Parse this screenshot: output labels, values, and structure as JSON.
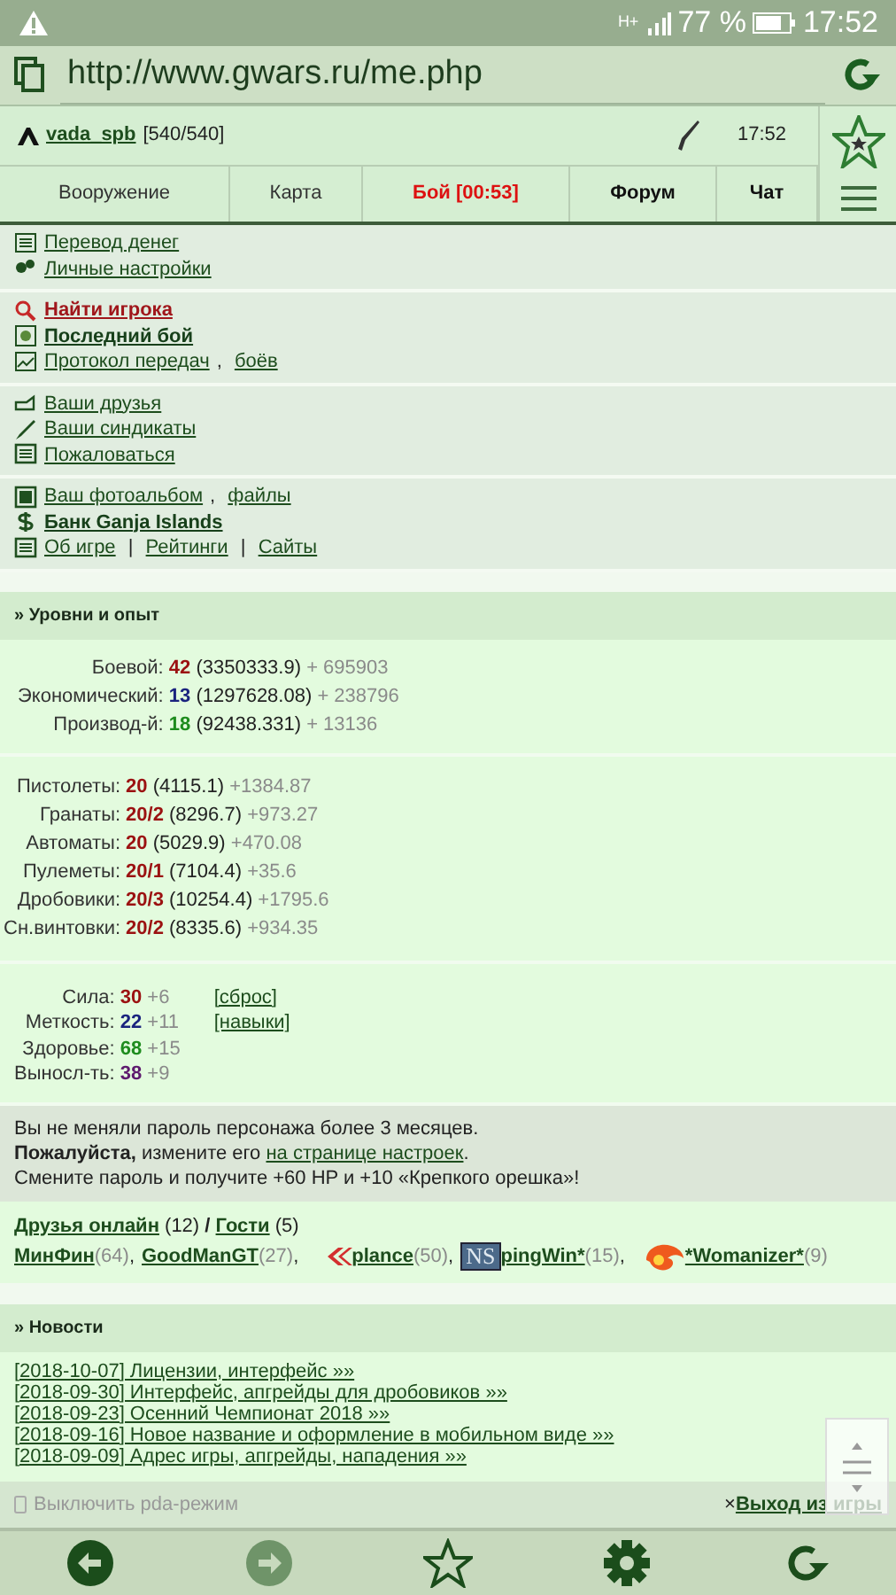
{
  "status_bar": {
    "network": "H+",
    "battery": "77 %",
    "time": "17:52"
  },
  "address_bar": {
    "url": "http://www.gwars.ru/me.php"
  },
  "header": {
    "user": "vada_spb",
    "hp": "[540/540]",
    "time": "17:52"
  },
  "nav_tabs": [
    {
      "label": "Вооружение",
      "kind": "plain"
    },
    {
      "label": "Карта",
      "kind": "plain"
    },
    {
      "label": "Бой [00:53]",
      "kind": "alert"
    },
    {
      "label": "Форум",
      "kind": "bold"
    },
    {
      "label": "Чат",
      "kind": "bold"
    }
  ],
  "menu_groups": [
    [
      {
        "kind": "plain",
        "links": [
          "Перевод денег"
        ]
      },
      {
        "kind": "plain",
        "links": [
          "Личные настройки"
        ]
      }
    ],
    [
      {
        "kind": "alert",
        "links": [
          "Найти игрока"
        ]
      },
      {
        "kind": "bold",
        "links": [
          "Последний бой"
        ]
      },
      {
        "kind": "plain",
        "links": [
          "Протокол передач",
          "боёв"
        ],
        "separator": ", "
      }
    ],
    [
      {
        "kind": "plain",
        "links": [
          "Ваши друзья"
        ]
      },
      {
        "kind": "plain",
        "links": [
          "Ваши синдикаты"
        ]
      },
      {
        "kind": "plain",
        "links": [
          "Пожаловаться"
        ]
      }
    ],
    [
      {
        "kind": "plain",
        "links": [
          "Ваш фотоальбом",
          "файлы"
        ],
        "separator": ", "
      },
      {
        "kind": "bold",
        "links": [
          "Банк Ganja Islands"
        ]
      },
      {
        "kind": "plain",
        "links": [
          "Об игре",
          "Рейтинги",
          "Сайты"
        ],
        "separator": " | "
      }
    ]
  ],
  "levels": {
    "title": "» Уровни и опыт",
    "experience": [
      {
        "label": "Боевой:",
        "value": "42",
        "color": "#9b1111",
        "total": "(3350333.9)",
        "gain": "+ 695903"
      },
      {
        "label": "Экономический:",
        "value": "13",
        "color": "#1a237e",
        "total": "(1297628.08)",
        "gain": "+ 238796"
      },
      {
        "label": "Производ-й:",
        "value": "18",
        "color": "#1e8c1e",
        "total": "(92438.331)",
        "gain": "+ 13136"
      }
    ],
    "weapons": [
      {
        "label": "Пистолеты:",
        "value": "20",
        "total": "(4115.1)",
        "gain": "+1384.87"
      },
      {
        "label": "Гранаты:",
        "value": "20/2",
        "total": "(8296.7)",
        "gain": "+973.27"
      },
      {
        "label": "Автоматы:",
        "value": "20",
        "total": "(5029.9)",
        "gain": "+470.08"
      },
      {
        "label": "Пулеметы:",
        "value": "20/1",
        "total": "(7104.4)",
        "gain": "+35.6"
      },
      {
        "label": "Дробовики:",
        "value": "20/3",
        "total": "(10254.4)",
        "gain": "+1795.6"
      },
      {
        "label": "Сн.винтовки:",
        "value": "20/2",
        "total": "(8335.6)",
        "gain": "+934.35"
      }
    ],
    "stats": [
      {
        "label": "Сила:",
        "value": "30",
        "color": "#9b1111",
        "gain": "+6",
        "link": "[сброс]"
      },
      {
        "label": "Меткость:",
        "value": "22",
        "color": "#1a237e",
        "gain": "+11",
        "link": "[навыки]"
      },
      {
        "label": "Здоровье:",
        "value": "68",
        "color": "#1e8c1e",
        "gain": "+15"
      },
      {
        "label": "Выносл-ть:",
        "value": "38",
        "color": "#5e1a6e",
        "gain": "+9"
      }
    ]
  },
  "notice": [
    {
      "text": "Вы не меняли пароль персонажа более 3 месяцев."
    },
    {
      "text": "**Пожалуйста,** измените его ",
      "link": "на странице настроек",
      "after": "."
    },
    {
      "text": "Смените пароль и получите +60 HP и +10 «Крепкого орешка»!"
    }
  ],
  "friends_online": {
    "friends_link": "Друзья онлайн",
    "friends_count": "(12)",
    "divider": "/",
    "guests_link": "Гости",
    "guests_count": "(5)",
    "separator": ",",
    "people": [
      {
        "name": "МинФин",
        "level": "(64)"
      },
      {
        "name": "GoodManGT",
        "level": "(27)"
      },
      {
        "name": "plance",
        "level": "(50)",
        "clan": {
          "kind": "arrows"
        }
      },
      {
        "name": "pingWin*",
        "level": "(15)",
        "clan": {
          "kind": "plate",
          "text": "NS"
        }
      },
      {
        "name": "*Womanizer*",
        "level": "(9)",
        "clan": {
          "kind": "flame"
        }
      }
    ]
  },
  "news": {
    "title": "» Новости",
    "items": [
      "[2018-10-07] Лицензии, интерфейс »»",
      "[2018-09-30] Интерфейс, апгрейды для дробовиков »»",
      "[2018-09-23] Осенний Чемпионат 2018 »»",
      "[2018-09-16] Новое название и оформление в мобильном виде »»",
      "[2018-09-09] Адрес игры, апгрейды, нападения »»"
    ]
  },
  "footer": {
    "pda_toggle": "Выключить pda-режим",
    "exit_mark": "×",
    "exit_link": "Выход из игры"
  }
}
